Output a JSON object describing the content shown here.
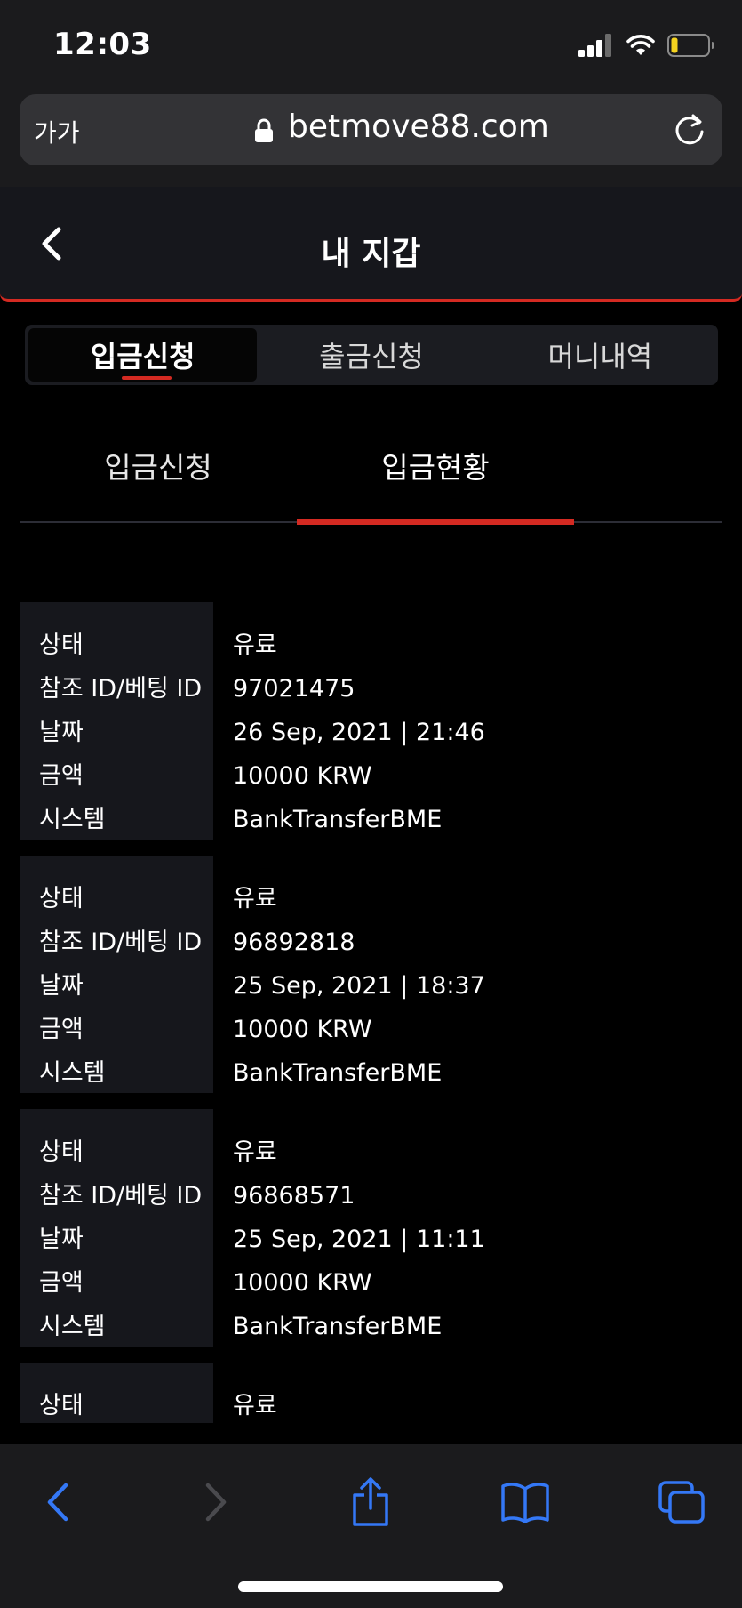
{
  "status_bar": {
    "time": "12:03"
  },
  "browser": {
    "text_size_button": "가가",
    "url": "betmove88.com"
  },
  "header": {
    "title": "내 지갑"
  },
  "main_tabs": [
    {
      "label": "입금신청",
      "active": true
    },
    {
      "label": "출금신청",
      "active": false
    },
    {
      "label": "머니내역",
      "active": false
    }
  ],
  "sub_tabs": [
    {
      "label": "입금신청",
      "active": false
    },
    {
      "label": "입금현황",
      "active": true
    }
  ],
  "field_labels": {
    "status": "상태",
    "ref_id": "참조 ID/베팅 ID",
    "date": "날짜",
    "amount": "금액",
    "system": "시스템"
  },
  "records": [
    {
      "status": "유료",
      "ref_id": "97021475",
      "date": "26 Sep, 2021 | 21:46",
      "amount": "10000 KRW",
      "system": "BankTransferBME"
    },
    {
      "status": "유료",
      "ref_id": "96892818",
      "date": "25 Sep, 2021 | 18:37",
      "amount": "10000 KRW",
      "system": "BankTransferBME"
    },
    {
      "status": "유료",
      "ref_id": "96868571",
      "date": "25 Sep, 2021 | 11:11",
      "amount": "10000 KRW",
      "system": "BankTransferBME"
    },
    {
      "status": "유료"
    }
  ],
  "colors": {
    "accent": "#d42a22",
    "link_blue": "#3478f6"
  }
}
